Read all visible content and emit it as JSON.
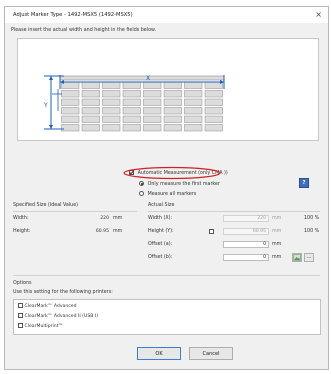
{
  "window": {
    "title": "Adjust Marker Type - 1492-MSX5 (1492-MSX5)",
    "close_glyph": "×"
  },
  "instruction": "Please insert the actual width and height in the fields below.",
  "preview": {
    "x_label": "X",
    "y_label": "Y"
  },
  "measurement": {
    "auto_label": "Automatic Measurement (only CMA ))",
    "options": [
      "Only measure the first marker",
      "Measure all markers"
    ],
    "selected": 0
  },
  "specified": {
    "heading": "Specified Size (Ideal Value)",
    "width_label": "Width:",
    "width_value": "220",
    "width_unit": "mm",
    "height_label": "Height:",
    "height_value": "60.95",
    "height_unit": "mm"
  },
  "actual": {
    "heading": "Actual Size",
    "width_label": "Width (X):",
    "width_value": "220",
    "width_unit": "mm",
    "width_pct": "100 %",
    "height_label": "Height (Y):",
    "height_value": "60.95",
    "height_unit": "mm",
    "height_pct": "100 %",
    "offset_a_label": "Offset (a):",
    "offset_a_value": "0",
    "offset_a_unit": "mm",
    "offset_b_label": "Offset (b):",
    "offset_b_value": "0",
    "offset_b_unit": "mm"
  },
  "options": {
    "heading": "Options",
    "subheading": "Use this setting for the following printers:",
    "printers": [
      "ClearMark™ Advanced",
      "ClearMark™ Advanced II (USB I)",
      "ClearMultiprint™"
    ]
  },
  "buttons": {
    "ok": "OK",
    "cancel": "Cancel",
    "help": "?",
    "more": "..."
  },
  "colors": {
    "accent": "#1e5fb8",
    "highlight_ellipse": "#d02020",
    "marker_fill": "#dcdcdc",
    "marker_stroke": "#8a8a8a"
  }
}
